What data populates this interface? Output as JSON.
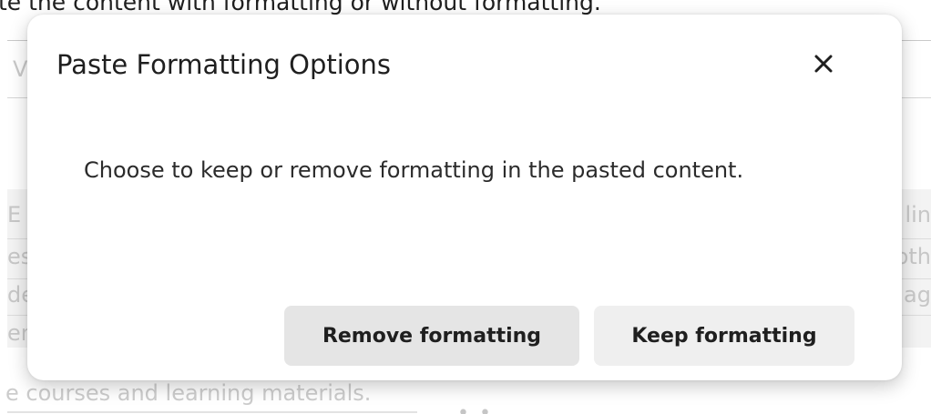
{
  "background": {
    "top_text": "te the content with formatting or without formatting.",
    "field_text": "V",
    "left_fragments": [
      "E",
      "es",
      "de",
      "en"
    ],
    "right_fragments": [
      "lin",
      "oth",
      "ag"
    ],
    "bottom_text": "e courses and learning materials.",
    "dots": "• •"
  },
  "dialog": {
    "title": "Paste Formatting Options",
    "close_icon": "×",
    "body": "Choose to keep or remove formatting in the pasted content.",
    "remove_button": "Remove formatting",
    "keep_button": "Keep formatting"
  }
}
